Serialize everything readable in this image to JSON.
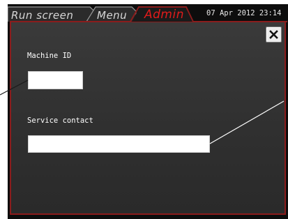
{
  "tabs": [
    {
      "label": "Run screen",
      "active": false
    },
    {
      "label": "Menu",
      "active": false
    },
    {
      "label": "Admin",
      "active": true
    }
  ],
  "header": {
    "datetime": "07 Apr 2012 23:14"
  },
  "close_button": {
    "icon": "close-icon",
    "glyph": "✕"
  },
  "form": {
    "machine_id": {
      "label": "Machine ID",
      "value": ""
    },
    "service_contact": {
      "label": "Service contact",
      "value": ""
    }
  },
  "colors": {
    "panel_border": "#8b1c1c",
    "active_tab_text": "#e11b1b",
    "inactive_tab_text": "#d7d7d7",
    "panel_bg": "#333333"
  }
}
